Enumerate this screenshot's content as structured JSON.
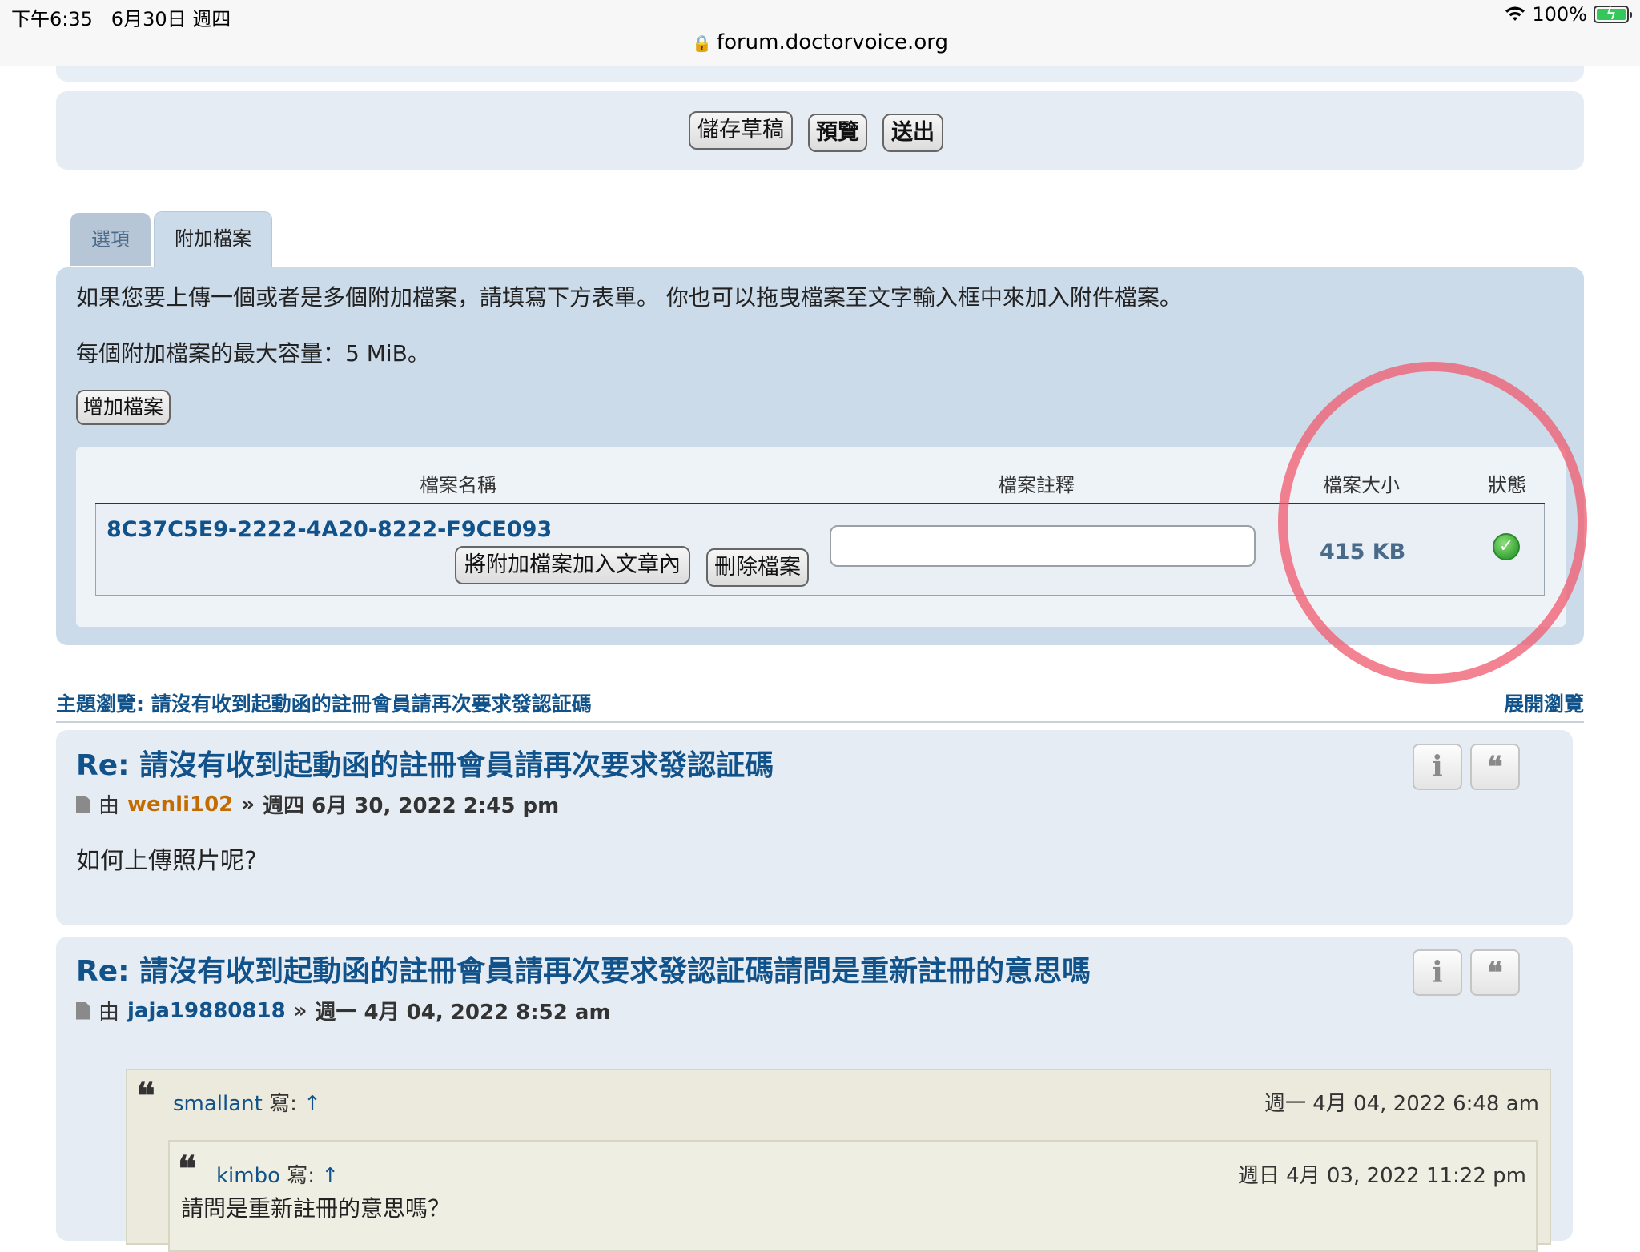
{
  "status_bar": {
    "time": "下午6:35",
    "date": "6月30日 週四",
    "battery": "100%",
    "url": "forum.doctorvoice.org"
  },
  "actions": {
    "save_draft": "儲存草稿",
    "preview": "預覽",
    "submit": "送出"
  },
  "tabs": {
    "options": "選項",
    "attachments": "附加檔案"
  },
  "attachments": {
    "instructions": "如果您要上傳一個或者是多個附加檔案，請填寫下方表單。 你也可以拖曳檔案至文字輸入框中來加入附件檔案。",
    "max_size": "每個附加檔案的最大容量：5 MiB。",
    "add_file": "增加檔案",
    "headers": {
      "name": "檔案名稱",
      "comment": "檔案註釋",
      "size": "檔案大小",
      "status": "狀態"
    },
    "file": {
      "name": "8C37C5E9-2222-4A20-8222-F9CE093",
      "insert_button": "將附加檔案加入文章內",
      "delete_button": "刪除檔案",
      "comment_value": "",
      "size": "415 KB"
    }
  },
  "topic": {
    "review_label": "主題瀏覽: 請沒有收到起動函的註冊會員請再次要求發認証碼",
    "expand": "展開瀏覽"
  },
  "posts": [
    {
      "title": "Re: 請沒有收到起動函的註冊會員請再次要求發認証碼",
      "by": "由",
      "author": "wenli102",
      "sep": "»",
      "date": "週四 6月 30, 2022 2:45 pm",
      "body": "如何上傳照片呢?"
    },
    {
      "title": "Re: 請沒有收到起動函的註冊會員請再次要求發認証碼請問是重新註冊的意思嗎",
      "by": "由",
      "author": "jaja19880818",
      "sep": "»",
      "date": "週一 4月 04, 2022 8:52 am",
      "quote": {
        "author": "smallant",
        "wrote": "寫:",
        "up": "↑",
        "date": "週一 4月 04, 2022 6:48 am",
        "nested": {
          "author": "kimbo",
          "wrote": "寫:",
          "up": "↑",
          "date": "週日 4月 03, 2022 11:22 pm",
          "text": "請問是重新註冊的意思嗎？"
        }
      }
    }
  ],
  "icons": {
    "info": "i",
    "quote": "❝",
    "status_ok": "✓"
  },
  "colors": {
    "link": "#105289",
    "author_orange": "#c46b00",
    "panel": "#ccdbe9",
    "post_bg": "#e6ecf3",
    "annotation_red": "#f05a6e"
  }
}
